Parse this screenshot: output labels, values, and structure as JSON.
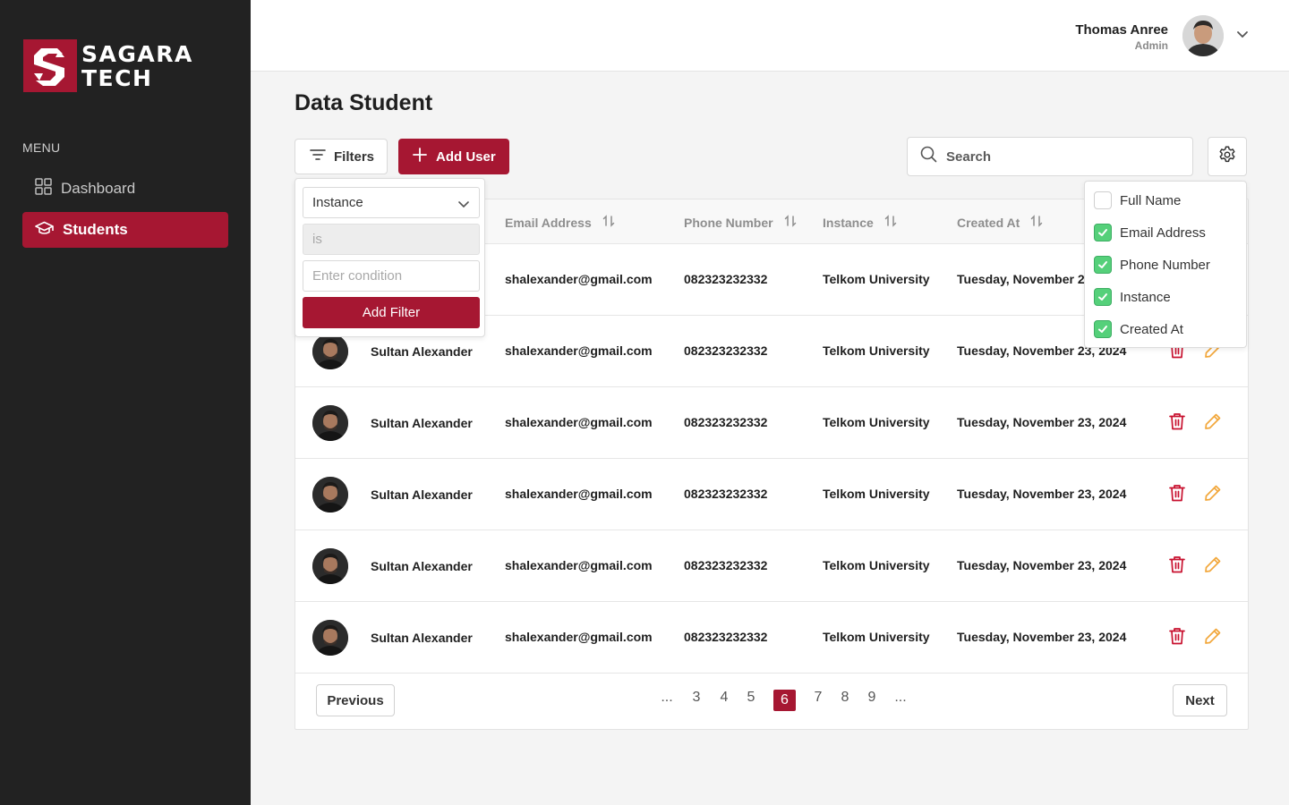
{
  "brand": {
    "line1": "SAGARA",
    "line2": "TECH",
    "color": "#a61732"
  },
  "sidebar": {
    "menu_title": "MENU",
    "items": [
      {
        "label": "Dashboard",
        "icon": "grid-icon",
        "active": false
      },
      {
        "label": "Students",
        "icon": "graduation-cap-icon",
        "active": true
      }
    ]
  },
  "header": {
    "user_name": "Thomas Anree",
    "user_role": "Admin"
  },
  "page": {
    "title": "Data Student"
  },
  "toolbar": {
    "filters_label": "Filters",
    "add_user_label": "Add User",
    "search_placeholder": "Search"
  },
  "filter_popup": {
    "field_value": "Instance",
    "operator_placeholder": "is",
    "condition_placeholder": "Enter condition",
    "add_label": "Add Filter"
  },
  "column_settings": {
    "items": [
      {
        "label": "Full Name",
        "checked": false
      },
      {
        "label": "Email Address",
        "checked": true
      },
      {
        "label": "Phone Number",
        "checked": true
      },
      {
        "label": "Instance",
        "checked": true
      },
      {
        "label": "Created At",
        "checked": true
      }
    ]
  },
  "table": {
    "columns": [
      "Email Address",
      "Phone Number",
      "Instance",
      "Created At"
    ],
    "rows": [
      {
        "name": "",
        "email": "shalexander@gmail.com",
        "phone": "082323232332",
        "instance": "Telkom University",
        "created": "Tuesday, November 23, 2024"
      },
      {
        "name": "Sultan Alexander",
        "email": "shalexander@gmail.com",
        "phone": "082323232332",
        "instance": "Telkom University",
        "created": "Tuesday, November 23, 2024"
      },
      {
        "name": "Sultan Alexander",
        "email": "shalexander@gmail.com",
        "phone": "082323232332",
        "instance": "Telkom University",
        "created": "Tuesday, November 23, 2024"
      },
      {
        "name": "Sultan Alexander",
        "email": "shalexander@gmail.com",
        "phone": "082323232332",
        "instance": "Telkom University",
        "created": "Tuesday, November 23, 2024"
      },
      {
        "name": "Sultan Alexander",
        "email": "shalexander@gmail.com",
        "phone": "082323232332",
        "instance": "Telkom University",
        "created": "Tuesday, November 23, 2024"
      },
      {
        "name": "Sultan Alexander",
        "email": "shalexander@gmail.com",
        "phone": "082323232332",
        "instance": "Telkom University",
        "created": "Tuesday, November 23, 2024"
      }
    ]
  },
  "pagination": {
    "previous_label": "Previous",
    "next_label": "Next",
    "pages": [
      "...",
      "3",
      "4",
      "5",
      "6",
      "7",
      "8",
      "9",
      "..."
    ],
    "current": "6"
  },
  "colors": {
    "accent": "#a61732",
    "sidebar_bg": "#222222",
    "delete": "#c8102e",
    "edit": "#f2a73b",
    "check": "#55d07a"
  }
}
